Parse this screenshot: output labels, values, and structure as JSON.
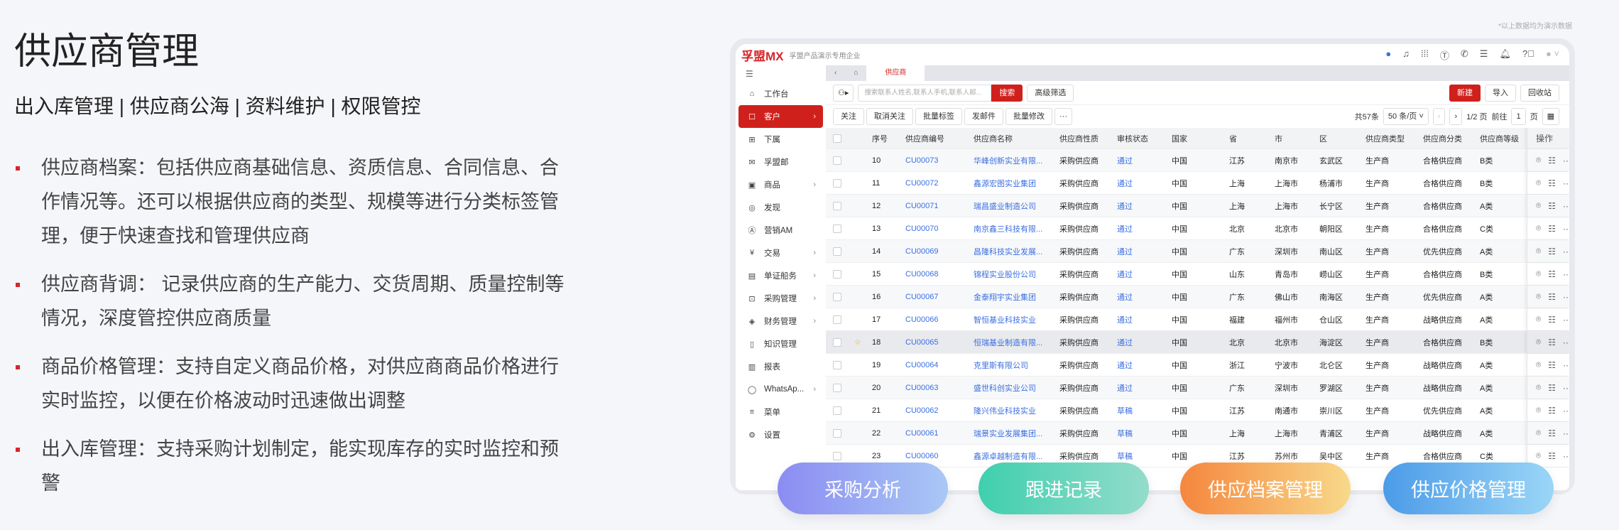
{
  "title": "供应商管理",
  "subtitle": "出入库管理 | 供应商公海 | 资料维护 | 权限管控",
  "bullets": [
    "供应商档案：包括供应商基础信息、资质信息、合同信息、合作情况等。还可以根据供应商的类型、规模等进行分类标签管理，便于快速查找和管理供应商",
    "供应商背调： 记录供应商的生产能力、交货周期、质量控制等情况，深度管控供应商质量",
    "商品价格管理：支持自定义商品价格，对供应商商品价格进行实时监控，以便在价格波动时迅速做出调整",
    "出入库管理：支持采购计划制定，能实现库存的实时监控和预警"
  ],
  "note": "*以上数据均为演示数据",
  "app": {
    "logo": "孚盟MX",
    "org": "孚盟产品演示专用企业",
    "sidebar": [
      {
        "label": "工作台",
        "icon": "⌂",
        "chev": false
      },
      {
        "label": "客户",
        "icon": "☐",
        "chev": true,
        "active": true
      },
      {
        "label": "下属",
        "icon": "⊞",
        "chev": false
      },
      {
        "label": "孚盟邮",
        "icon": "✉",
        "chev": false
      },
      {
        "label": "商品",
        "icon": "▣",
        "chev": true
      },
      {
        "label": "发现",
        "icon": "◎",
        "chev": false
      },
      {
        "label": "营销AM",
        "icon": "Ⓐ",
        "chev": false
      },
      {
        "label": "交易",
        "icon": "¥",
        "chev": true
      },
      {
        "label": "单证船务",
        "icon": "▤",
        "chev": true
      },
      {
        "label": "采购管理",
        "icon": "⊡",
        "chev": true
      },
      {
        "label": "财务管理",
        "icon": "◈",
        "chev": true
      },
      {
        "label": "知识管理",
        "icon": "▯",
        "chev": false
      },
      {
        "label": "报表",
        "icon": "▥",
        "chev": false
      },
      {
        "label": "WhatsAp...",
        "icon": "◯",
        "chev": true
      },
      {
        "label": "菜单",
        "icon": "≡",
        "chev": false
      },
      {
        "label": "设置",
        "icon": "⚙",
        "chev": false
      }
    ],
    "tab": "供应商",
    "search_placeholder": "搜索联系人姓名,联系人手机,联系人邮...",
    "search_btn": "搜索",
    "adv_filter": "高级筛选",
    "new_btn": "新建",
    "import_btn": "导入",
    "recycle_btn": "回收站",
    "actions": [
      "关注",
      "取消关注",
      "批量标签",
      "发邮件",
      "批量修改",
      "···"
    ],
    "pager": {
      "total": "共57条",
      "size": "50 条/页",
      "pages": "1/2 页",
      "goto": "前往",
      "page": "1",
      "unit": "页"
    },
    "columns": [
      "序号",
      "供应商编号",
      "供应商名称",
      "供应商性质",
      "审核状态",
      "国家",
      "省",
      "市",
      "区",
      "供应商类型",
      "供应商分类",
      "供应商等级",
      "操作"
    ],
    "rows": [
      [
        "10",
        "CU00073",
        "华峰创新实业有限...",
        "采购供应商",
        "通过",
        "中国",
        "江苏",
        "南京市",
        "玄武区",
        "生产商",
        "合格供应商",
        "B类"
      ],
      [
        "11",
        "CU00072",
        "鑫源宏图实业集团",
        "采购供应商",
        "通过",
        "中国",
        "上海",
        "上海市",
        "杨浦市",
        "生产商",
        "合格供应商",
        "B类"
      ],
      [
        "12",
        "CU00071",
        "瑞昌盛业制造公司",
        "采购供应商",
        "通过",
        "中国",
        "上海",
        "上海市",
        "长宁区",
        "生产商",
        "合格供应商",
        "A类"
      ],
      [
        "13",
        "CU00070",
        "南京鑫三科技有限...",
        "采购供应商",
        "通过",
        "中国",
        "北京",
        "北京市",
        "朝阳区",
        "生产商",
        "合格供应商",
        "C类"
      ],
      [
        "14",
        "CU00069",
        "昌隆科技实业发展...",
        "采购供应商",
        "通过",
        "中国",
        "广东",
        "深圳市",
        "南山区",
        "生产商",
        "优先供应商",
        "A类"
      ],
      [
        "15",
        "CU00068",
        "锦程实业股份公司",
        "采购供应商",
        "通过",
        "中国",
        "山东",
        "青岛市",
        "崂山区",
        "生产商",
        "合格供应商",
        "B类"
      ],
      [
        "16",
        "CU00067",
        "金泰翔宇实业集团",
        "采购供应商",
        "通过",
        "中国",
        "广东",
        "佛山市",
        "南海区",
        "生产商",
        "优先供应商",
        "A类"
      ],
      [
        "17",
        "CU00066",
        "智恒基业科技实业",
        "采购供应商",
        "通过",
        "中国",
        "福建",
        "福州市",
        "仓山区",
        "生产商",
        "战略供应商",
        "A类"
      ],
      [
        "18",
        "CU00065",
        "恒瑞基业制造有限...",
        "采购供应商",
        "通过",
        "中国",
        "北京",
        "北京市",
        "海淀区",
        "生产商",
        "合格供应商",
        "B类"
      ],
      [
        "19",
        "CU00064",
        "克里斯有限公司",
        "采购供应商",
        "通过",
        "中国",
        "浙江",
        "宁波市",
        "北仑区",
        "生产商",
        "战略供应商",
        "A类"
      ],
      [
        "20",
        "CU00063",
        "盛世科创实业公司",
        "采购供应商",
        "通过",
        "中国",
        "广东",
        "深圳市",
        "罗湖区",
        "生产商",
        "战略供应商",
        "A类"
      ],
      [
        "21",
        "CU00062",
        "隆兴伟业科技实业",
        "采购供应商",
        "草稿",
        "中国",
        "江苏",
        "南通市",
        "崇川区",
        "生产商",
        "优先供应商",
        "A类"
      ],
      [
        "22",
        "CU00061",
        "瑞景实业发展集团...",
        "采购供应商",
        "草稿",
        "中国",
        "上海",
        "上海市",
        "青浦区",
        "生产商",
        "战略供应商",
        "A类"
      ],
      [
        "23",
        "CU00060",
        "鑫源卓越制造有限...",
        "采购供应商",
        "草稿",
        "中国",
        "江苏",
        "苏州市",
        "吴中区",
        "生产商",
        "合格供应商",
        "C类"
      ]
    ]
  },
  "pills": [
    {
      "label": "采购分析",
      "from": "#8b8cf2",
      "to": "#a9c8f5"
    },
    {
      "label": "跟进记录",
      "from": "#3fcfae",
      "to": "#93dccb"
    },
    {
      "label": "供应档案管理",
      "from": "#f5863d",
      "to": "#f8d98a"
    },
    {
      "label": "供应价格管理",
      "from": "#4b9be8",
      "to": "#9bd6f7"
    }
  ]
}
